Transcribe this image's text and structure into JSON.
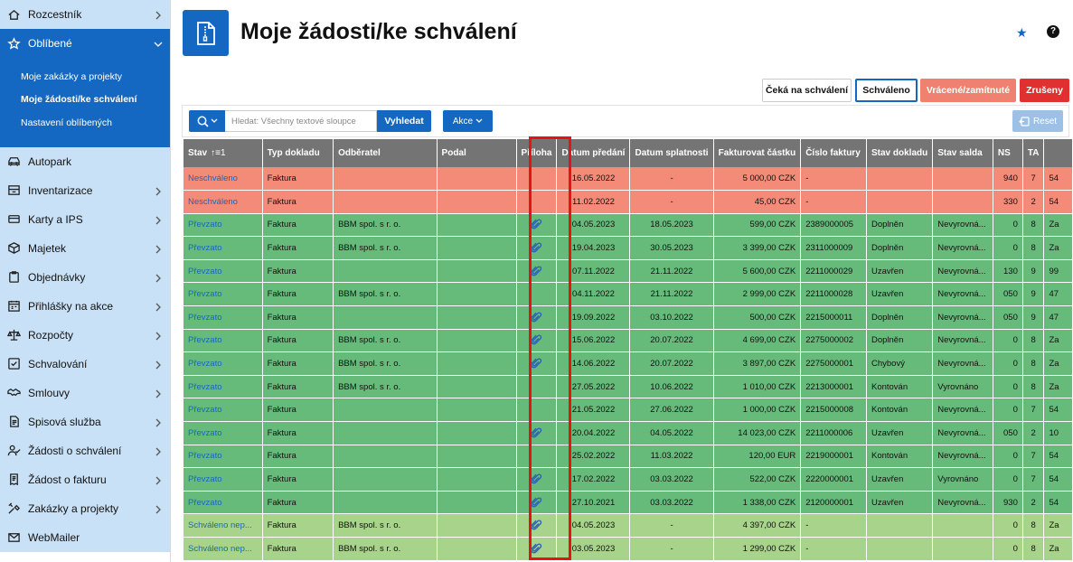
{
  "sidebar": {
    "items": [
      {
        "label": "Rozcestník",
        "icon": "home-icon"
      },
      {
        "label": "Oblíbené",
        "icon": "star-icon"
      },
      {
        "label": "Autopark",
        "icon": "car-icon"
      },
      {
        "label": "Inventarizace",
        "icon": "inventory-icon"
      },
      {
        "label": "Karty a IPS",
        "icon": "card-icon"
      },
      {
        "label": "Majetek",
        "icon": "box-icon"
      },
      {
        "label": "Objednávky",
        "icon": "clipboard-icon"
      },
      {
        "label": "Přihlášky na akce",
        "icon": "calendar-icon"
      },
      {
        "label": "Rozpočty",
        "icon": "scale-icon"
      },
      {
        "label": "Schvalování",
        "icon": "check-icon"
      },
      {
        "label": "Smlouvy",
        "icon": "handshake-icon"
      },
      {
        "label": "Spisová služba",
        "icon": "document-icon"
      },
      {
        "label": "Žádosti o schválení",
        "icon": "user-check-icon"
      },
      {
        "label": "Žádost o fakturu",
        "icon": "invoice-icon"
      },
      {
        "label": "Zakázky a projekty",
        "icon": "tools-icon"
      },
      {
        "label": "WebMailer",
        "icon": "mail-icon"
      }
    ],
    "favorites": [
      "Moje zakázky a projekty",
      "Moje žádosti/ke schválení",
      "Nastavení oblíbených"
    ]
  },
  "header": {
    "title": "Moje žádosti/ke schválení"
  },
  "tabs": {
    "ceka": "Čeká na schválení",
    "schvaleno": "Schváleno",
    "vracene": "Vrácené/zamítnuté",
    "zruseny": "Zrušeny"
  },
  "toolbar": {
    "search_placeholder": "Hledat: Všechny textové sloupce",
    "search_button": "Vyhledat",
    "actions_button": "Akce",
    "reset_button": "Reset"
  },
  "table": {
    "columns": [
      "Stav",
      "Typ dokladu",
      "Odběratel",
      "Podal",
      "Příloha",
      "Datum předání",
      "Datum splatnosti",
      "Fakturovat částku",
      "Číslo faktury",
      "Stav dokladu",
      "Stav salda",
      "NS",
      "TA",
      ""
    ],
    "sort_indicator": "↑≡1",
    "rows": [
      {
        "status": "neschvaleno",
        "stav": "Neschváleno",
        "typ": "Faktura",
        "odberatel": "",
        "podal": "",
        "priloha": false,
        "datum_predani": "16.05.2022",
        "datum_splatnosti": "-",
        "castka": "5 000,00 CZK",
        "cislo": "-",
        "stav_dokladu": "",
        "stav_salda": "",
        "ns": "940",
        "ta": "7",
        "x": "54"
      },
      {
        "status": "neschvaleno",
        "stav": "Neschváleno",
        "typ": "Faktura",
        "odberatel": "",
        "podal": "",
        "priloha": false,
        "datum_predani": "11.02.2022",
        "datum_splatnosti": "-",
        "castka": "45,00 CZK",
        "cislo": "-",
        "stav_dokladu": "",
        "stav_salda": "",
        "ns": "330",
        "ta": "2",
        "x": "54"
      },
      {
        "status": "prevzato",
        "stav": "Převzato",
        "typ": "Faktura",
        "odberatel": "BBM spol. s r. o.",
        "podal": "",
        "priloha": true,
        "datum_predani": "04.05.2023",
        "datum_splatnosti": "18.05.2023",
        "castka": "599,00 CZK",
        "cislo": "2389000005",
        "stav_dokladu": "Doplněn",
        "stav_salda": "Nevyrovná...",
        "ns": "0",
        "ta": "8",
        "x": "Za"
      },
      {
        "status": "prevzato",
        "stav": "Převzato",
        "typ": "Faktura",
        "odberatel": "BBM spol. s r. o.",
        "podal": "",
        "priloha": true,
        "datum_predani": "19.04.2023",
        "datum_splatnosti": "30.05.2023",
        "castka": "3 399,00 CZK",
        "cislo": "2311000009",
        "stav_dokladu": "Doplněn",
        "stav_salda": "Nevyrovná...",
        "ns": "0",
        "ta": "8",
        "x": "Za"
      },
      {
        "status": "prevzato",
        "stav": "Převzato",
        "typ": "Faktura",
        "odberatel": "",
        "podal": "",
        "priloha": true,
        "datum_predani": "07.11.2022",
        "datum_splatnosti": "21.11.2022",
        "castka": "5 600,00 CZK",
        "cislo": "2211000029",
        "stav_dokladu": "Uzavřen",
        "stav_salda": "Nevyrovná...",
        "ns": "130",
        "ta": "9",
        "x": "99"
      },
      {
        "status": "prevzato",
        "stav": "Převzato",
        "typ": "Faktura",
        "odberatel": "BBM spol. s r. o.",
        "podal": "",
        "priloha": false,
        "datum_predani": "04.11.2022",
        "datum_splatnosti": "21.11.2022",
        "castka": "2 999,00 CZK",
        "cislo": "2211000028",
        "stav_dokladu": "Uzavřen",
        "stav_salda": "Nevyrovná...",
        "ns": "050",
        "ta": "9",
        "x": "47"
      },
      {
        "status": "prevzato",
        "stav": "Převzato",
        "typ": "Faktura",
        "odberatel": "",
        "podal": "",
        "priloha": true,
        "datum_predani": "19.09.2022",
        "datum_splatnosti": "03.10.2022",
        "castka": "500,00 CZK",
        "cislo": "2215000011",
        "stav_dokladu": "Doplněn",
        "stav_salda": "Nevyrovná...",
        "ns": "050",
        "ta": "9",
        "x": "47"
      },
      {
        "status": "prevzato",
        "stav": "Převzato",
        "typ": "Faktura",
        "odberatel": "BBM spol. s r. o.",
        "podal": "",
        "priloha": true,
        "datum_predani": "15.06.2022",
        "datum_splatnosti": "20.07.2022",
        "castka": "4 699,00 CZK",
        "cislo": "2275000002",
        "stav_dokladu": "Doplněn",
        "stav_salda": "Nevyrovná...",
        "ns": "0",
        "ta": "8",
        "x": "Za"
      },
      {
        "status": "prevzato",
        "stav": "Převzato",
        "typ": "Faktura",
        "odberatel": "BBM spol. s r. o.",
        "podal": "",
        "priloha": true,
        "datum_predani": "14.06.2022",
        "datum_splatnosti": "20.07.2022",
        "castka": "3 897,00 CZK",
        "cislo": "2275000001",
        "stav_dokladu": "Chybový",
        "stav_salda": "Nevyrovná...",
        "ns": "0",
        "ta": "8",
        "x": "Za"
      },
      {
        "status": "prevzato",
        "stav": "Převzato",
        "typ": "Faktura",
        "odberatel": "BBM spol. s r. o.",
        "podal": "",
        "priloha": false,
        "datum_predani": "27.05.2022",
        "datum_splatnosti": "10.06.2022",
        "castka": "1 010,00 CZK",
        "cislo": "2213000001",
        "stav_dokladu": "Kontován",
        "stav_salda": "Vyrovnáno",
        "ns": "0",
        "ta": "8",
        "x": "Za"
      },
      {
        "status": "prevzato",
        "stav": "Převzato",
        "typ": "Faktura",
        "odberatel": "",
        "podal": "",
        "priloha": false,
        "datum_predani": "21.05.2022",
        "datum_splatnosti": "27.06.2022",
        "castka": "1 000,00 CZK",
        "cislo": "2215000008",
        "stav_dokladu": "Kontován",
        "stav_salda": "Nevyrovná...",
        "ns": "0",
        "ta": "7",
        "x": "54"
      },
      {
        "status": "prevzato",
        "stav": "Převzato",
        "typ": "Faktura",
        "odberatel": "",
        "podal": "",
        "priloha": true,
        "datum_predani": "20.04.2022",
        "datum_splatnosti": "04.05.2022",
        "castka": "14 023,00 CZK",
        "cislo": "2211000006",
        "stav_dokladu": "Uzavřen",
        "stav_salda": "Nevyrovná...",
        "ns": "050",
        "ta": "2",
        "x": "10"
      },
      {
        "status": "prevzato",
        "stav": "Převzato",
        "typ": "Faktura",
        "odberatel": "",
        "podal": "",
        "priloha": false,
        "datum_predani": "25.02.2022",
        "datum_splatnosti": "11.03.2022",
        "castka": "120,00 EUR",
        "cislo": "2219000001",
        "stav_dokladu": "Kontován",
        "stav_salda": "Nevyrovná...",
        "ns": "0",
        "ta": "7",
        "x": "54"
      },
      {
        "status": "prevzato",
        "stav": "Převzato",
        "typ": "Faktura",
        "odberatel": "",
        "podal": "",
        "priloha": true,
        "datum_predani": "17.02.2022",
        "datum_splatnosti": "03.03.2022",
        "castka": "522,00 CZK",
        "cislo": "2220000001",
        "stav_dokladu": "Uzavřen",
        "stav_salda": "Vyrovnáno",
        "ns": "0",
        "ta": "7",
        "x": "54"
      },
      {
        "status": "prevzato",
        "stav": "Převzato",
        "typ": "Faktura",
        "odberatel": "",
        "podal": "",
        "priloha": true,
        "datum_predani": "27.10.2021",
        "datum_splatnosti": "03.03.2022",
        "castka": "1 338,00 CZK",
        "cislo": "2120000001",
        "stav_dokladu": "Uzavřen",
        "stav_salda": "Nevyrovná...",
        "ns": "930",
        "ta": "2",
        "x": "54"
      },
      {
        "status": "schvaleno",
        "stav": "Schváleno nep...",
        "typ": "Faktura",
        "odberatel": "BBM spol. s r. o.",
        "podal": "",
        "priloha": true,
        "datum_predani": "04.05.2023",
        "datum_splatnosti": "-",
        "castka": "4 397,00 CZK",
        "cislo": "-",
        "stav_dokladu": "",
        "stav_salda": "",
        "ns": "0",
        "ta": "8",
        "x": "Za"
      },
      {
        "status": "schvaleno",
        "stav": "Schváleno nep...",
        "typ": "Faktura",
        "odberatel": "BBM spol. s r. o.",
        "podal": "",
        "priloha": true,
        "datum_predani": "03.05.2023",
        "datum_splatnosti": "-",
        "castka": "1 299,00 CZK",
        "cislo": "-",
        "stav_dokladu": "",
        "stav_salda": "",
        "ns": "0",
        "ta": "8",
        "x": "Za"
      }
    ]
  },
  "colors": {
    "brand": "#1468c2",
    "row_neschvaleno": "#f48b78",
    "row_prevzato": "#66bb7a",
    "row_schvaleno": "#a8d38a",
    "highlight": "#e31414"
  }
}
